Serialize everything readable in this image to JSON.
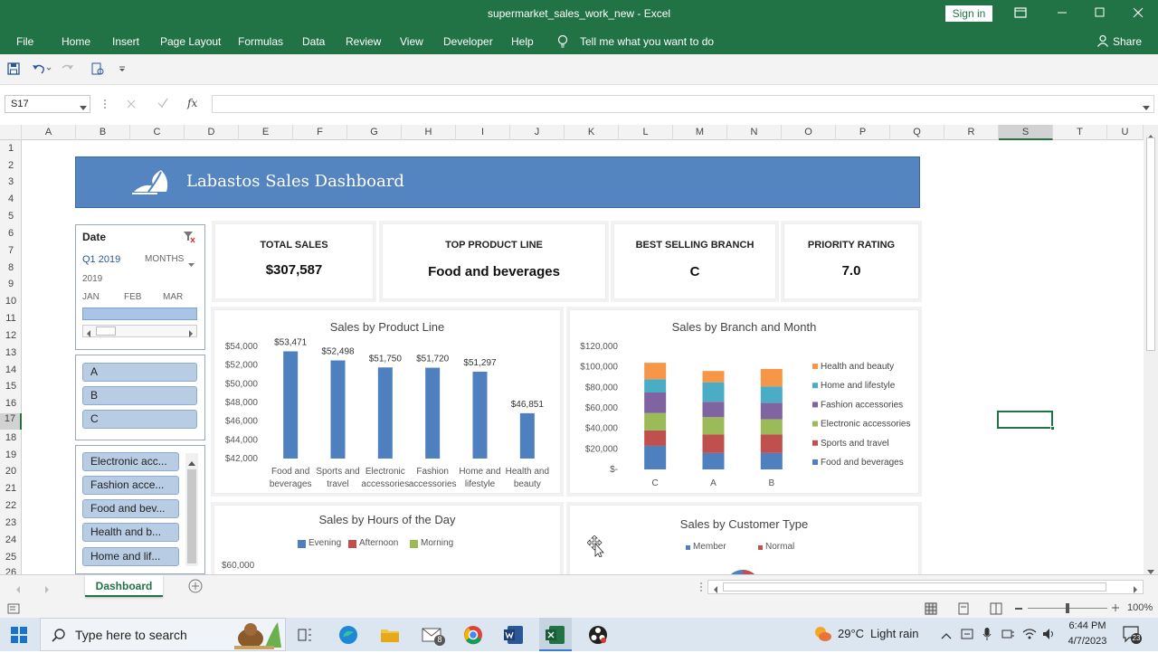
{
  "window": {
    "title": "supermarket_sales_work_new  -  Excel",
    "signin": "Sign in"
  },
  "ribbon": {
    "tabs": [
      "File",
      "Home",
      "Insert",
      "Page Layout",
      "Formulas",
      "Data",
      "Review",
      "View",
      "Developer",
      "Help"
    ],
    "tellme": "Tell me what you want to do",
    "share": "Share"
  },
  "formula": {
    "namebox": "S17",
    "fx": "fx",
    "value": ""
  },
  "columns": [
    "A",
    "B",
    "C",
    "D",
    "E",
    "F",
    "G",
    "H",
    "I",
    "J",
    "K",
    "L",
    "M",
    "N",
    "O",
    "P",
    "Q",
    "R",
    "S",
    "T",
    "U"
  ],
  "rows": [
    "1",
    "2",
    "3",
    "4",
    "5",
    "6",
    "7",
    "8",
    "9",
    "10",
    "11",
    "12",
    "13",
    "14",
    "15",
    "16",
    "17",
    "18",
    "19",
    "20",
    "21",
    "22",
    "23",
    "24",
    "25",
    "26"
  ],
  "dashboard": {
    "title": "Labastos Sales Dashboard",
    "kpis": [
      {
        "label": "TOTAL SALES",
        "value": "$307,587"
      },
      {
        "label": "TOP PRODUCT LINE",
        "value": "Food and beverages"
      },
      {
        "label": "BEST SELLING BRANCH",
        "value": "C"
      },
      {
        "label": "PRIORITY RATING",
        "value": "7.0"
      }
    ],
    "date_slicer": {
      "header": "Date",
      "period": "Q1 2019",
      "mode": "MONTHS",
      "year": "2019",
      "months": [
        "JAN",
        "FEB",
        "MAR"
      ]
    },
    "branch_slicer": [
      "A",
      "B",
      "C"
    ],
    "product_slicer": [
      "Electronic acc...",
      "Fashion acce...",
      "Food and bev...",
      "Health and b...",
      "Home and lif..."
    ]
  },
  "chart_data": [
    {
      "type": "bar",
      "title": "Sales by Product Line",
      "categories": [
        "Food and beverages",
        "Sports and travel",
        "Electronic accessories",
        "Fashion accessories",
        "Home and lifestyle",
        "Health and beauty"
      ],
      "category_lines": [
        [
          "Food and",
          "beverages"
        ],
        [
          "Sports and",
          "travel"
        ],
        [
          "Electronic",
          "accessories"
        ],
        [
          "Fashion",
          "accessories"
        ],
        [
          "Home and",
          "lifestyle"
        ],
        [
          "Health and",
          "beauty"
        ]
      ],
      "values": [
        53471,
        52498,
        51750,
        51720,
        51297,
        46851
      ],
      "data_labels": [
        "$53,471",
        "$52,498",
        "$51,750",
        "$51,720",
        "$51,297",
        "$46,851"
      ],
      "ylim": [
        42000,
        54000
      ],
      "yticks": [
        "$42,000",
        "$44,000",
        "$46,000",
        "$48,000",
        "$50,000",
        "$52,000",
        "$54,000"
      ],
      "color": "#4e7fbf"
    },
    {
      "type": "bar",
      "stacked": true,
      "title": "Sales by Branch and Month",
      "categories": [
        "C",
        "A",
        "B"
      ],
      "ylim": [
        0,
        120000
      ],
      "yticks": [
        "$-",
        "$20,000",
        "$40,000",
        "$60,000",
        "$80,000",
        "$100,000",
        "$120,000"
      ],
      "legend_position": "right",
      "series": [
        {
          "name": "Food and beverages",
          "color": "#4e7fbf",
          "values": [
            23000,
            16000,
            16000
          ]
        },
        {
          "name": "Sports and travel",
          "color": "#c0504d",
          "values": [
            15000,
            18000,
            18000
          ]
        },
        {
          "name": "Electronic accessories",
          "color": "#9bbb59",
          "values": [
            17000,
            17000,
            15000
          ]
        },
        {
          "name": "Fashion accessories",
          "color": "#7f64a1",
          "values": [
            20000,
            15000,
            16000
          ]
        },
        {
          "name": "Home and lifestyle",
          "color": "#4bacc6",
          "values": [
            13000,
            19000,
            16000
          ]
        },
        {
          "name": "Health and beauty",
          "color": "#f79646",
          "values": [
            16000,
            11000,
            17000
          ]
        }
      ]
    },
    {
      "type": "line",
      "title": "Sales by Hours of the Day",
      "legend": [
        {
          "name": "Evening",
          "color": "#4e7fbf"
        },
        {
          "name": "Afternoon",
          "color": "#c0504d"
        },
        {
          "name": "Morning",
          "color": "#9bbb59"
        }
      ],
      "yticks": [
        "$60,000"
      ]
    },
    {
      "type": "pie",
      "title": "Sales by Customer Type",
      "legend": [
        {
          "name": "Member",
          "color": "#4e7fbf"
        },
        {
          "name": "Normal",
          "color": "#c0504d"
        }
      ]
    }
  ],
  "sheet_tab": "Dashboard",
  "status": {
    "zoom": "100%"
  },
  "taskbar": {
    "search": "Type here to search",
    "temp": "29°C",
    "weather": "Light rain",
    "time": "6:44 PM",
    "date": "4/7/2023",
    "mail_badge": "8",
    "notif_badge": "23"
  }
}
